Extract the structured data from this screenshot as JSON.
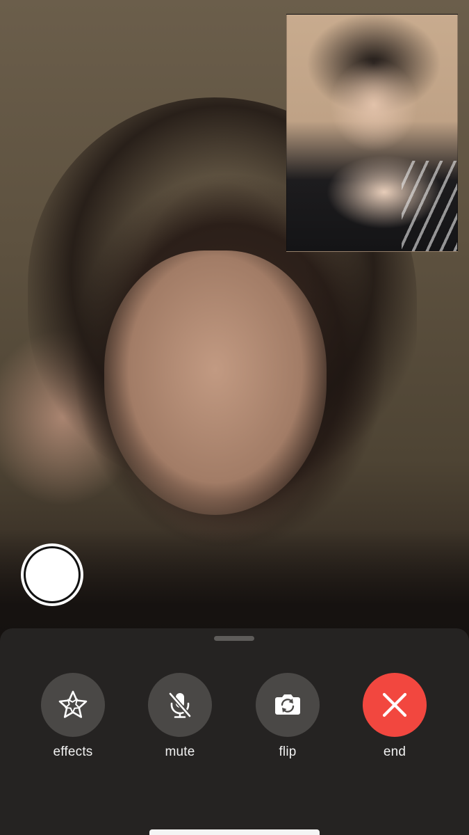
{
  "controls": {
    "effects_label": "effects",
    "mute_label": "mute",
    "flip_label": "flip",
    "end_label": "end"
  },
  "icons": {
    "effects": "star-effects-icon",
    "mute": "microphone-muted-icon",
    "flip": "camera-flip-icon",
    "end": "close-x-icon",
    "capture": "shutter-icon"
  },
  "colors": {
    "end_button": "#f2473f",
    "control_button": "#4a4846",
    "panel_background": "#262423"
  }
}
